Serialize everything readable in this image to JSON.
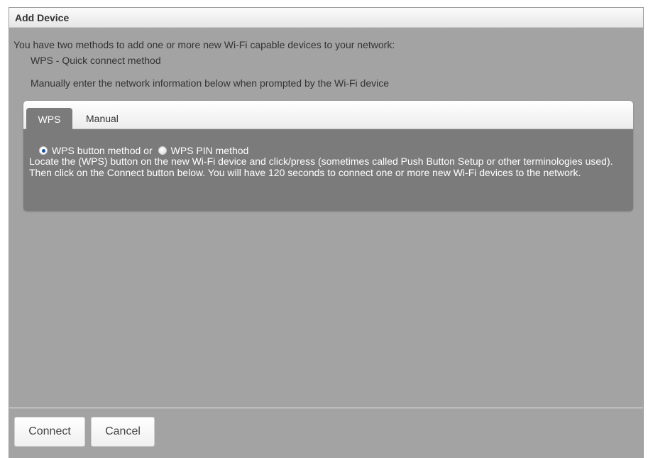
{
  "dialog": {
    "title": "Add Device"
  },
  "intro": {
    "text": "You have two methods to add one or more new Wi-Fi capable devices to your network:",
    "methods": [
      "WPS - Quick connect method",
      "Manually enter the network information below when prompted by the Wi-Fi device"
    ]
  },
  "tabs": [
    {
      "label": "WPS",
      "active": true
    },
    {
      "label": "Manual",
      "active": false
    }
  ],
  "wps": {
    "options": [
      {
        "label": "WPS button method or",
        "selected": true
      },
      {
        "label": "WPS PIN method",
        "selected": false
      }
    ],
    "description": "Locate the (WPS) button on the new Wi-Fi device and click/press (sometimes called Push Button Setup or other terminologies used). Then click on the Connect button below. You will have 120 seconds to connect one or more new Wi-Fi devices to the network."
  },
  "buttons": {
    "connect": "Connect",
    "cancel": "Cancel"
  }
}
